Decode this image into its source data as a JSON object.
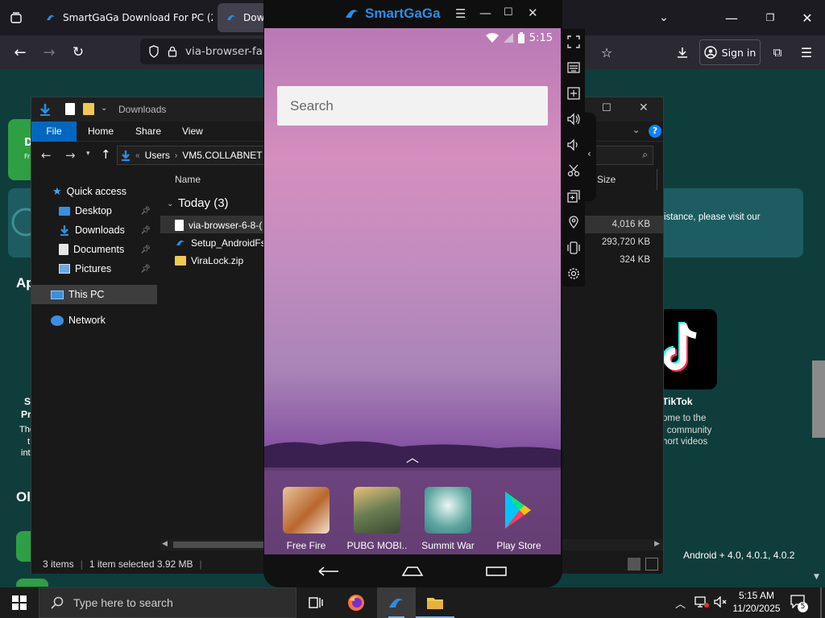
{
  "browser": {
    "tabs": [
      {
        "label": "SmartGaGa Download For PC (2",
        "active": false
      },
      {
        "label": "Down",
        "active": true
      }
    ],
    "url": "via-browser-fa",
    "sign_in_label": "Sign in"
  },
  "website": {
    "banner_text": "istance, please visit our",
    "heading_fragment_apps": "Ap",
    "heading_fragment_ol": "Ol",
    "left_fragments": [
      "D",
      "Fr",
      "S",
      "Pri",
      "The",
      "t",
      "int"
    ],
    "tiktok": {
      "name": "TikTok",
      "desc_lines": [
        "ome to the",
        "l community",
        "hort videos"
      ]
    },
    "android_versions": "Android + 4.0, 4.0.1, 4.0.2"
  },
  "explorer": {
    "title": "Downloads",
    "ribbon_tabs": [
      "File",
      "Home",
      "Share",
      "View"
    ],
    "address_parts": [
      "Users",
      "VM5.COLLABNET"
    ],
    "sidebar": [
      {
        "label": "Quick access",
        "icon": "star-icon"
      },
      {
        "label": "Desktop",
        "icon": "desktop-folder-icon",
        "pinned": true
      },
      {
        "label": "Downloads",
        "icon": "download-arrow-icon",
        "pinned": true
      },
      {
        "label": "Documents",
        "icon": "documents-icon",
        "pinned": true
      },
      {
        "label": "Pictures",
        "icon": "pictures-icon",
        "pinned": true
      },
      {
        "label": "This PC",
        "icon": "pc-icon"
      },
      {
        "label": "Network",
        "icon": "network-icon"
      }
    ],
    "columns": {
      "name": "Name",
      "size": "Size"
    },
    "group_header": "Today (3)",
    "files": [
      {
        "name": "via-browser-6-8-(",
        "size": "4,016 KB"
      },
      {
        "name": "Setup_AndroidFs",
        "size": "293,720 KB"
      },
      {
        "name": "ViraLock.zip",
        "size": "324 KB"
      }
    ],
    "status": {
      "items": "3 items",
      "selected": "1 item selected  3.92 MB"
    }
  },
  "emulator": {
    "brand": "SmartGaGa",
    "time": "5:15",
    "search_placeholder": "Search",
    "apps": [
      {
        "label": "Free Fire",
        "color": "#c97a3a"
      },
      {
        "label": "PUBG MOBI..",
        "color": "#6a7d52"
      },
      {
        "label": "Summit War",
        "color": "#5fa7a1"
      },
      {
        "label": "Play Store",
        "color": "#ffffff"
      }
    ]
  },
  "taskbar": {
    "search_placeholder": "Type here to search",
    "time": "5:15 AM",
    "date": "11/20/2025",
    "notification_count": "5"
  },
  "colors": {
    "site_bg": "#0f3d3c",
    "accent": "#0a84ff",
    "smartgaga_blue": "#2a8ee6"
  }
}
